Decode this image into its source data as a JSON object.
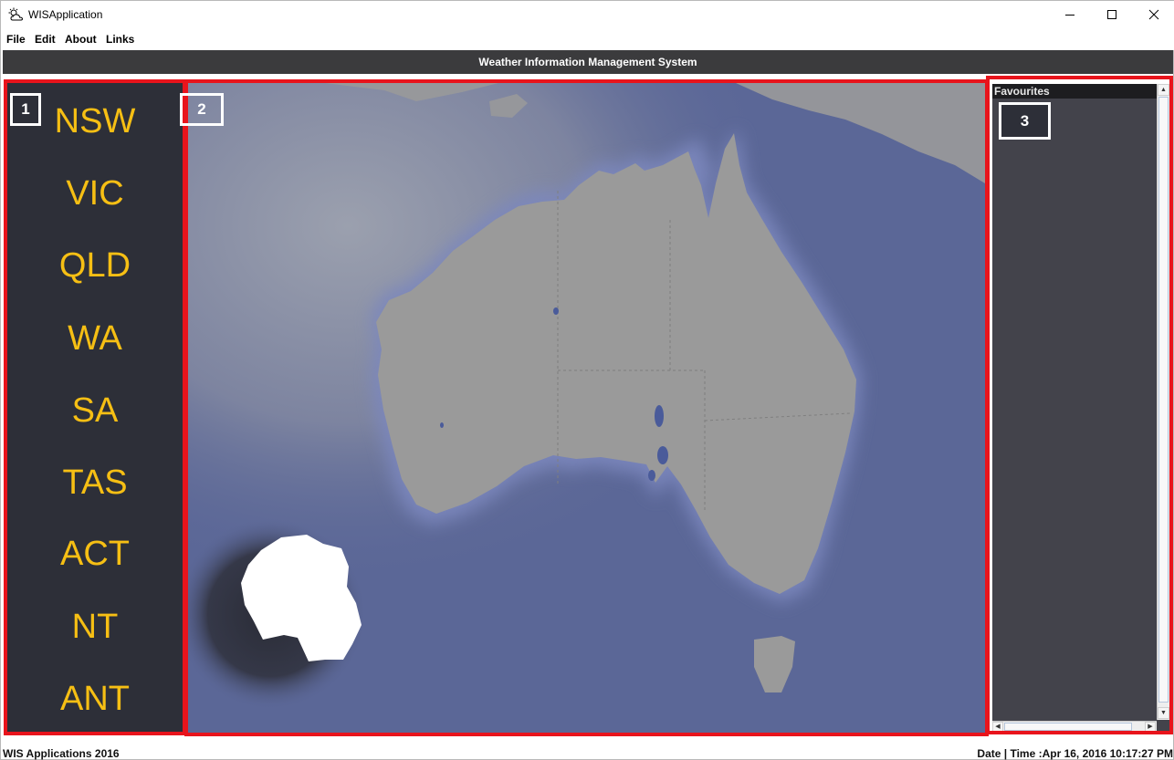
{
  "window": {
    "title": "WISApplication",
    "icon": "cloud-sun-icon",
    "controls": [
      "minimize-icon",
      "maximize-icon",
      "close-icon"
    ]
  },
  "menu": [
    "File",
    "Edit",
    "About",
    "Links"
  ],
  "header": {
    "title": "Weather Information Management System"
  },
  "states": [
    "NSW",
    "VIC",
    "QLD",
    "WA",
    "SA",
    "TAS",
    "ACT",
    "NT",
    "ANT"
  ],
  "favourites": {
    "title": "Favourites",
    "items": []
  },
  "annotations": [
    "1",
    "2",
    "3"
  ],
  "status": {
    "left": "WIS Applications 2016",
    "right": "Date | Time :Apr 16, 2016 10:17:27 PM"
  },
  "colors": {
    "state_text": "#f6bf14",
    "panel_bg": "#2d2f38",
    "header_bg": "#3b3b3d",
    "annotation_frame": "#e8141c",
    "ocean": "#5b6797",
    "land": "#9a9a9a"
  }
}
